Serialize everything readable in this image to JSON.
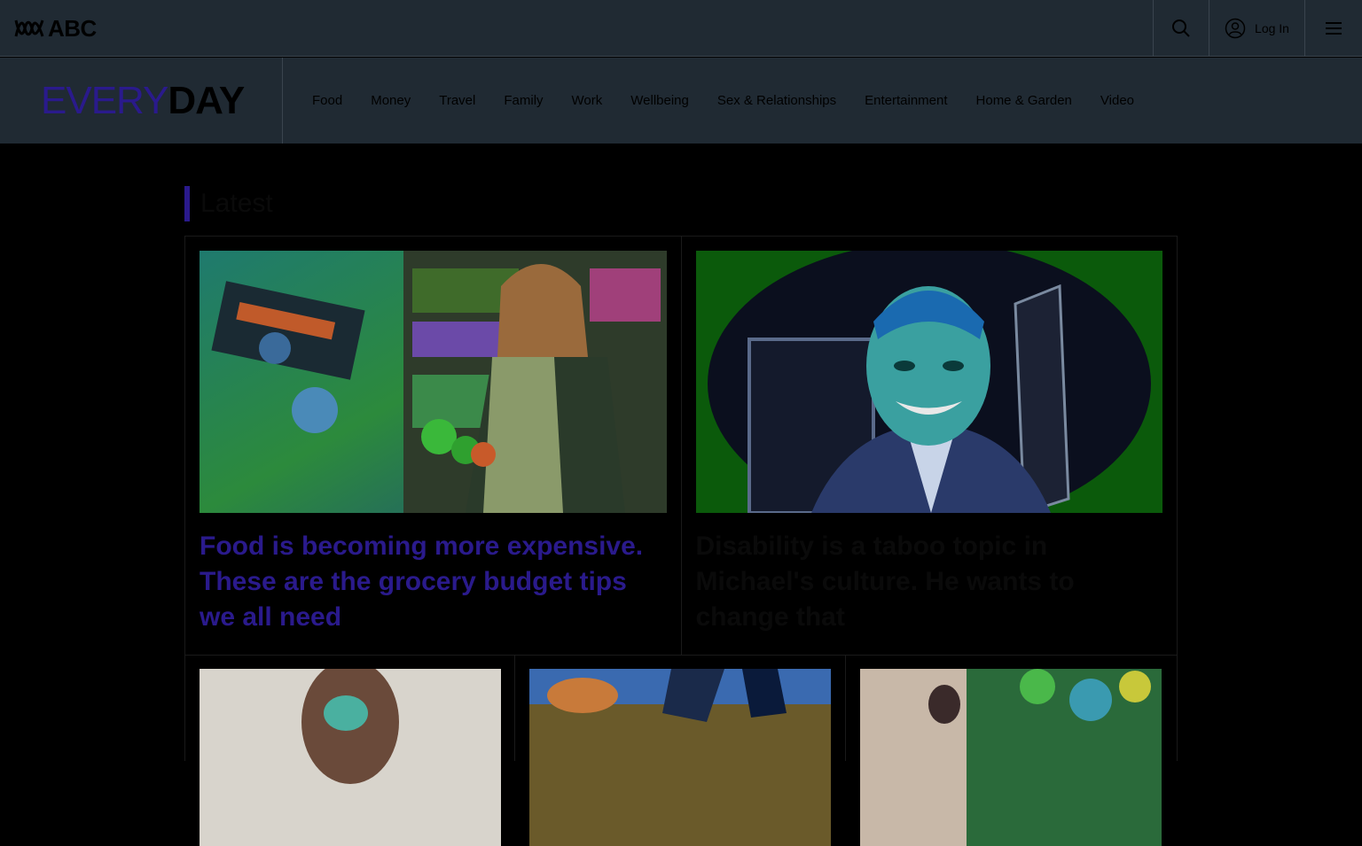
{
  "header": {
    "brand_word": "ABC",
    "login_label": "Log In"
  },
  "section": {
    "logo_every": "EVERY",
    "logo_day": "DAY",
    "nav": [
      "Food",
      "Money",
      "Travel",
      "Family",
      "Work",
      "Wellbeing",
      "Sex & Relationships",
      "Entertainment",
      "Home & Garden",
      "Video"
    ]
  },
  "latest": {
    "heading": "Latest",
    "featured": [
      {
        "headline": "Food is becoming more expensive. These are the grocery budget tips we all need"
      },
      {
        "headline": "Disability is a taboo topic in Michael's culture. He wants to change that"
      }
    ]
  },
  "colors": {
    "accent": "#2a1a8c",
    "header_bg": "#202a33",
    "page_bg": "#000000"
  },
  "icons": {
    "search": "search-icon",
    "account": "account-icon",
    "menu": "hamburger-menu-icon"
  }
}
